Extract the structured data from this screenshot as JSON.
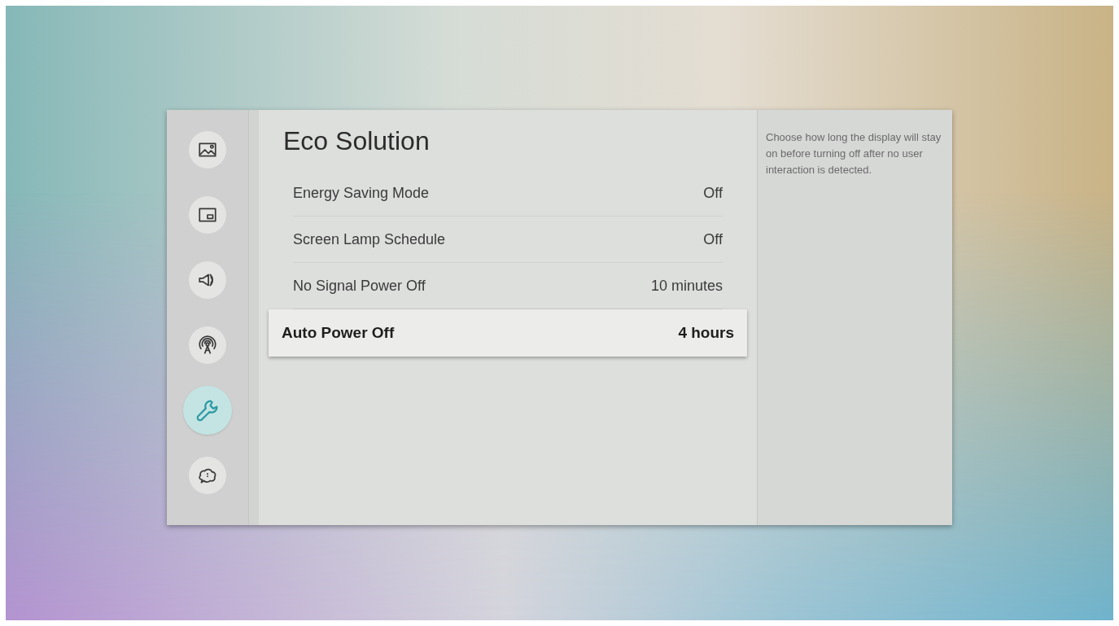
{
  "sidebar": {
    "items": [
      {
        "selected": false
      },
      {
        "selected": false
      },
      {
        "selected": false
      },
      {
        "selected": false
      },
      {
        "selected": true
      },
      {
        "selected": false
      }
    ]
  },
  "panel": {
    "title": "Eco Solution",
    "items": [
      {
        "label": "Energy Saving Mode",
        "value": "Off",
        "selected": false
      },
      {
        "label": "Screen Lamp Schedule",
        "value": "Off",
        "selected": false
      },
      {
        "label": "No Signal Power Off",
        "value": "10 minutes",
        "selected": false
      },
      {
        "label": "Auto Power Off",
        "value": "4 hours",
        "selected": true
      }
    ]
  },
  "description": "Choose how long the display will stay on before turning off after no user interaction is detected."
}
